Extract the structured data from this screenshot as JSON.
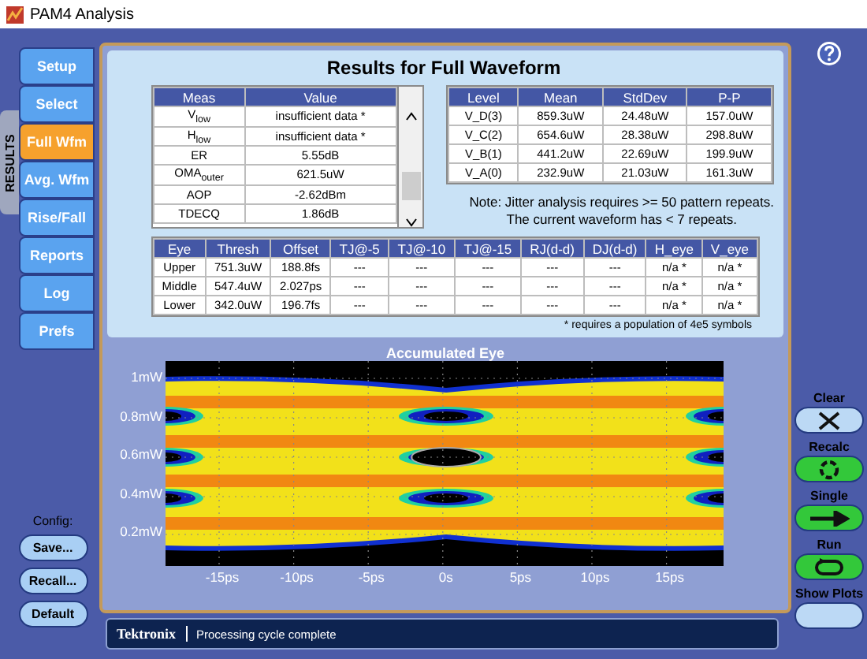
{
  "window": {
    "title": "PAM4 Analysis"
  },
  "side_tab": {
    "label": "RESULTS",
    "selected": true
  },
  "nav": [
    {
      "label": "Setup",
      "selected": false
    },
    {
      "label": "Select",
      "selected": false
    },
    {
      "label": "Full Wfm",
      "selected": true
    },
    {
      "label": "Avg. Wfm",
      "selected": false
    },
    {
      "label": "Rise/Fall",
      "selected": false
    },
    {
      "label": "Reports",
      "selected": false
    },
    {
      "label": "Log",
      "selected": false
    },
    {
      "label": "Prefs",
      "selected": false
    }
  ],
  "config": {
    "label": "Config:",
    "buttons": [
      "Save...",
      "Recall...",
      "Default"
    ]
  },
  "results": {
    "title": "Results for Full Waveform",
    "meas_table": {
      "columns": [
        "Meas",
        "Value"
      ],
      "rows": [
        [
          "V$_{low}$",
          "insufficient data *"
        ],
        [
          "H$_{low}$",
          "insufficient data *"
        ],
        [
          "ER",
          "5.55dB"
        ],
        [
          "OMA$_{outer}$",
          "621.5uW"
        ],
        [
          "AOP",
          "-2.62dBm"
        ],
        [
          "TDECQ",
          "1.86dB"
        ]
      ]
    },
    "level_table": {
      "columns": [
        "Level",
        "Mean",
        "StdDev",
        "P-P"
      ],
      "rows": [
        [
          "V_D(3)",
          "859.3uW",
          "24.48uW",
          "157.0uW"
        ],
        [
          "V_C(2)",
          "654.6uW",
          "28.38uW",
          "298.8uW"
        ],
        [
          "V_B(1)",
          "441.2uW",
          "22.69uW",
          "199.9uW"
        ],
        [
          "V_A(0)",
          "232.9uW",
          "21.03uW",
          "161.3uW"
        ]
      ]
    },
    "note": [
      "Note: Jitter analysis requires >= 50 pattern repeats.",
      "The current waveform has < 7 repeats."
    ],
    "eye_table": {
      "columns": [
        "Eye",
        "Thresh",
        "Offset",
        "TJ@-5",
        "TJ@-10",
        "TJ@-15",
        "RJ(d-d)",
        "DJ(d-d)",
        "H_eye",
        "V_eye"
      ],
      "rows": [
        [
          "Upper",
          "751.3uW",
          "188.8fs",
          "---",
          "---",
          "---",
          "---",
          "---",
          "n/a *",
          "n/a *"
        ],
        [
          "Middle",
          "547.4uW",
          "2.027ps",
          "---",
          "---",
          "---",
          "---",
          "---",
          "n/a *",
          "n/a *"
        ],
        [
          "Lower",
          "342.0uW",
          "196.7fs",
          "---",
          "---",
          "---",
          "---",
          "---",
          "n/a *",
          "n/a *"
        ]
      ]
    },
    "footnote": "* requires a population of 4e5 symbols"
  },
  "eye_plot": {
    "title": "Accumulated Eye",
    "y_ticks": [
      "1mW",
      "0.8mW",
      "0.6mW",
      "0.4mW",
      "0.2mW"
    ],
    "x_ticks": [
      "-15ps",
      "-10ps",
      "-5ps",
      "0s",
      "5ps",
      "10ps",
      "15ps"
    ]
  },
  "controls": [
    {
      "label": "Clear",
      "kind": "clear"
    },
    {
      "label": "Recalc",
      "kind": "recalc"
    },
    {
      "label": "Single",
      "kind": "single"
    },
    {
      "label": "Run",
      "kind": "run"
    },
    {
      "label": "Show Plots",
      "kind": "plots"
    }
  ],
  "status_bar": {
    "brand": "Tektronix",
    "message": "Processing cycle complete"
  }
}
